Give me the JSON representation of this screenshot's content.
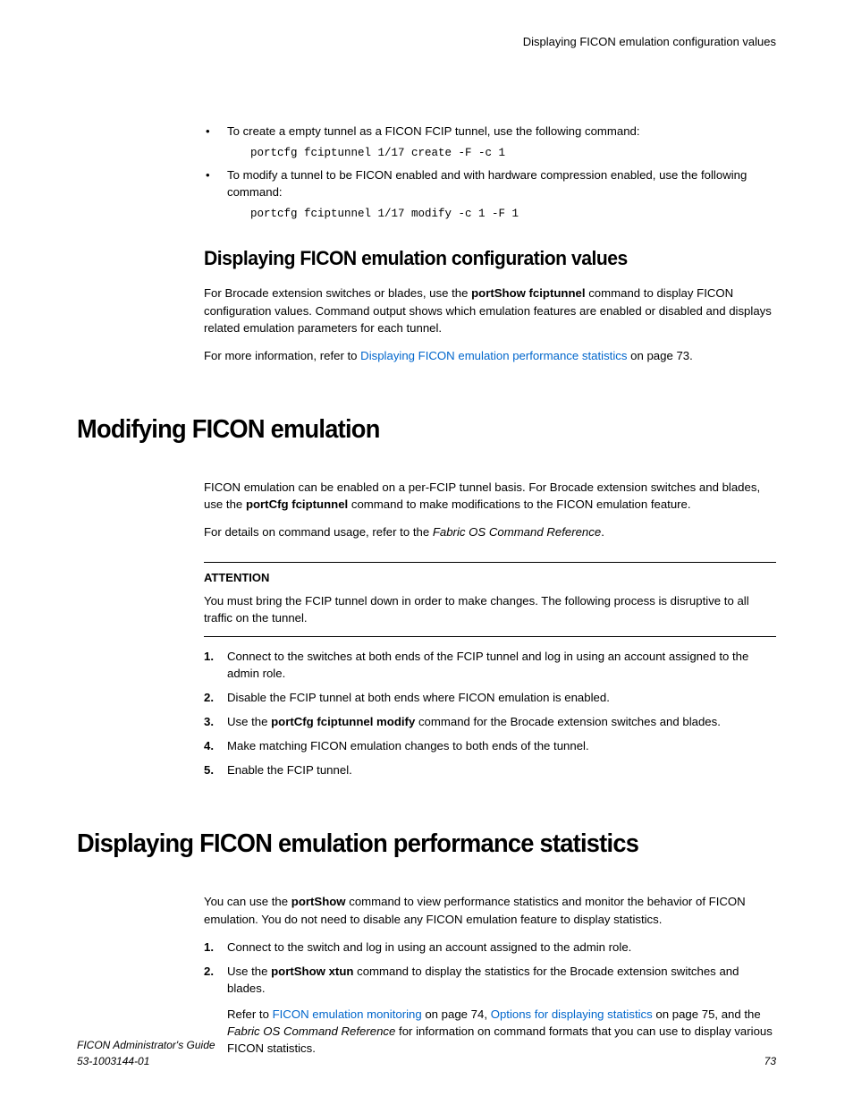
{
  "running_head": "Displaying FICON emulation configuration values",
  "bullets": {
    "b1": "To create a empty tunnel as a FICON FCIP tunnel, use the following command:",
    "code1": "portcfg fciptunnel 1/17 create -F -c 1",
    "b2": "To modify a tunnel to be FICON enabled and with hardware compression enabled, use the following command:",
    "code2": "portcfg fciptunnel 1/17 modify -c 1 -F 1"
  },
  "section1": {
    "title": "Displaying FICON emulation configuration values",
    "p1_a": "For Brocade extension switches or blades, use the ",
    "p1_bold": "portShow fciptunnel",
    "p1_b": " command to display FICON configuration values. Command output shows which emulation features are enabled or disabled and displays related emulation parameters for each tunnel.",
    "p2_a": "For more information, refer to ",
    "p2_link": "Displaying FICON emulation performance statistics",
    "p2_b": " on page 73."
  },
  "section2": {
    "title": "Modifying FICON emulation",
    "p1_a": "FICON emulation can be enabled on a per-FCIP tunnel basis. For Brocade extension switches and blades, use the ",
    "p1_bold": "portCfg fciptunnel",
    "p1_b": " command to make modifications to the FICON emulation feature.",
    "p2_a": "For details on command usage, refer to the ",
    "p2_italic": "Fabric OS Command Reference",
    "p2_b": ".",
    "attention_label": "ATTENTION",
    "attention_body": "You must bring the FCIP tunnel down in order to make changes. The following process is disruptive to all traffic on the tunnel.",
    "step1": "Connect to the switches at both ends of the FCIP tunnel and log in using an account assigned to the admin role.",
    "step2": "Disable the FCIP tunnel at both ends where FICON emulation is enabled.",
    "step3_a": "Use the ",
    "step3_bold": "portCfg fciptunnel modify",
    "step3_b": " command for the Brocade extension switches and blades.",
    "step4": "Make matching FICON emulation changes to both ends of the tunnel.",
    "step5": "Enable the FCIP tunnel."
  },
  "section3": {
    "title": "Displaying FICON emulation performance statistics",
    "p1_a": "You can use the ",
    "p1_bold": "portShow",
    "p1_b": " command to view performance statistics and monitor the behavior of FICON emulation. You do not need to disable any FICON emulation feature to display statistics.",
    "step1": "Connect to the switch and log in using an account assigned to the admin role.",
    "step2_a": "Use the ",
    "step2_bold": "portShow xtun",
    "step2_b": " command to display the statistics for the Brocade extension switches and blades.",
    "step2_body_a": "Refer to ",
    "step2_link1": "FICON emulation monitoring",
    "step2_body_b": " on page 74, ",
    "step2_link2": "Options for displaying statistics",
    "step2_body_c": " on page 75, and the ",
    "step2_italic": "Fabric OS Command Reference",
    "step2_body_d": " for information on command formats that you can use to display various FICON statistics."
  },
  "footer": {
    "title": "FICON Administrator's Guide",
    "docnum": "53-1003144-01",
    "page": "73"
  }
}
